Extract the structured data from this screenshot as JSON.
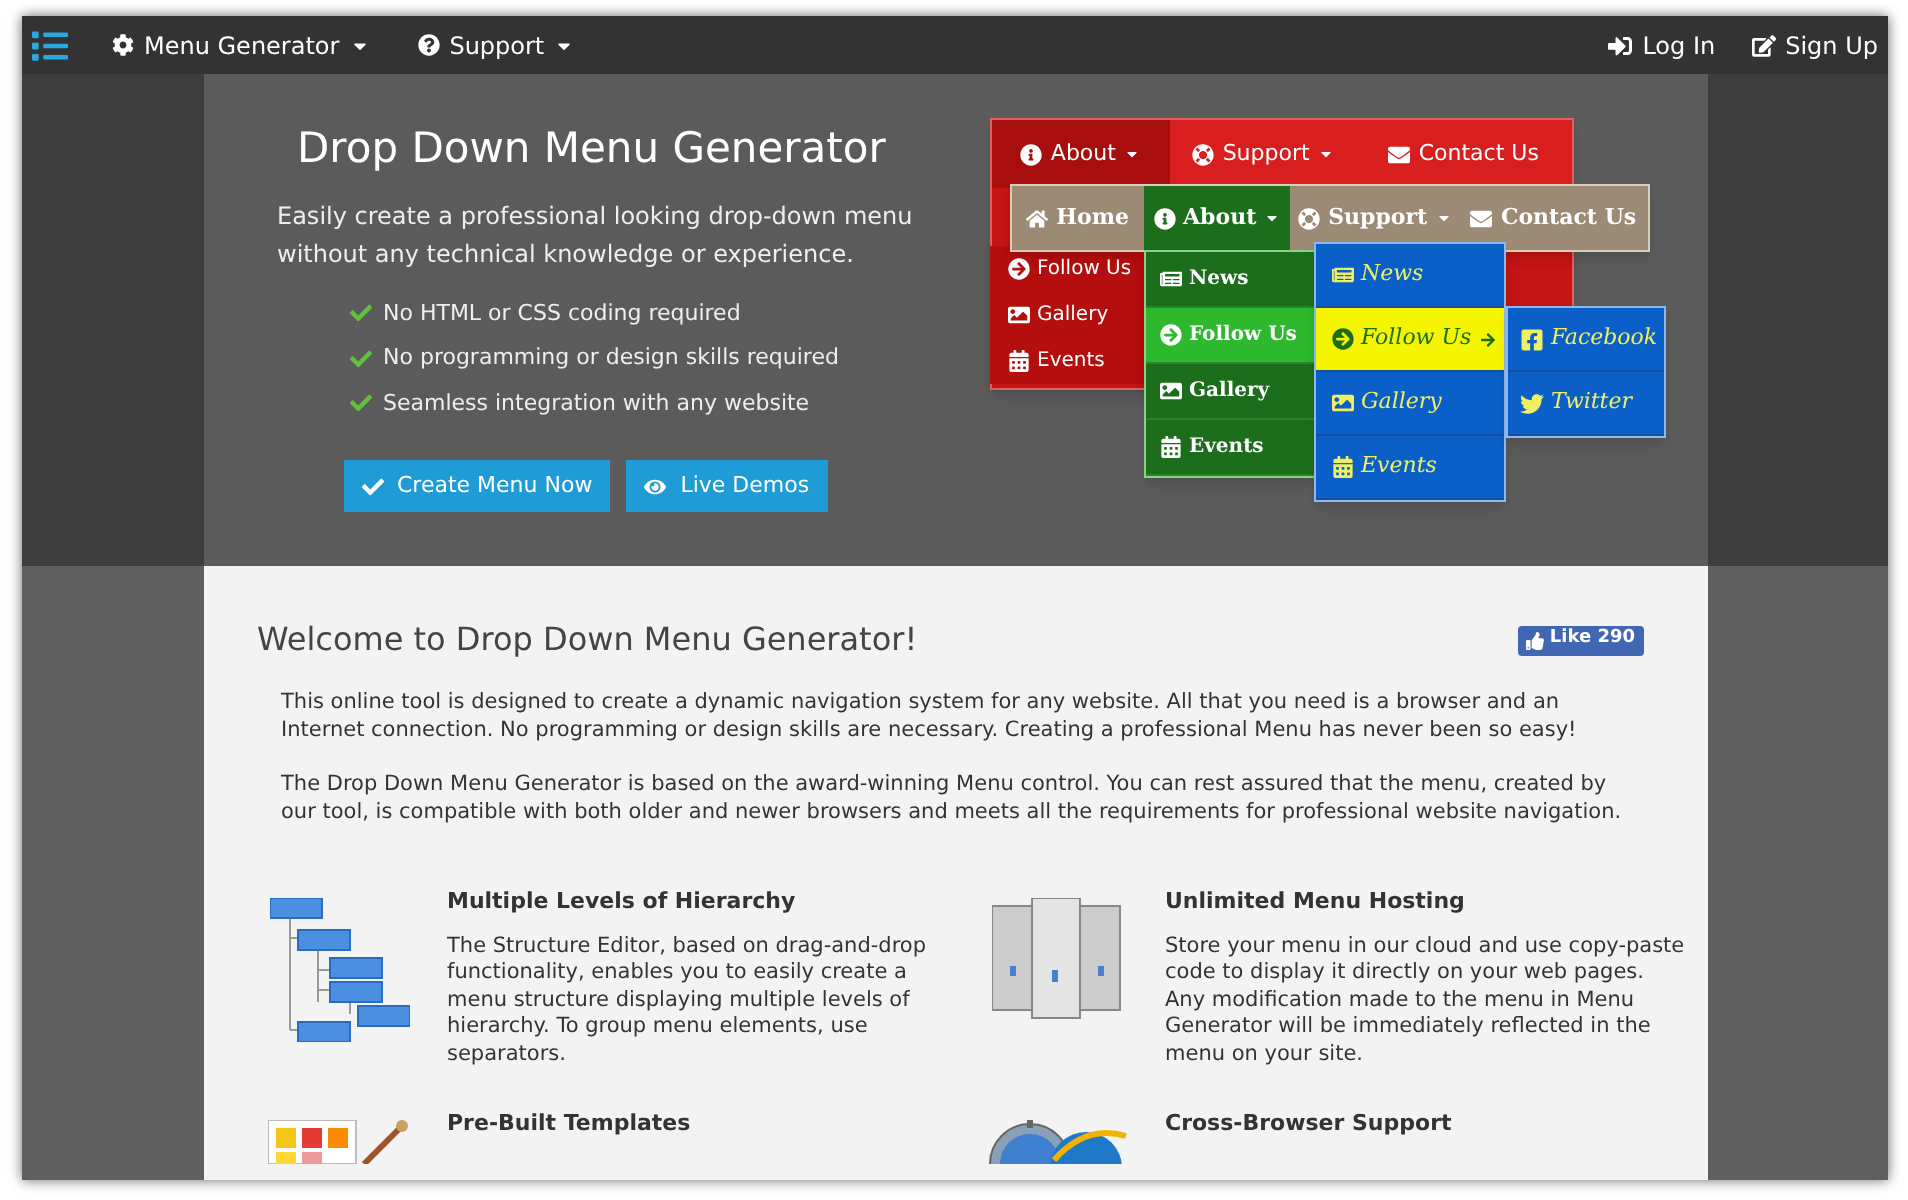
{
  "navbar": {
    "menus": [
      {
        "label": "Menu Generator"
      },
      {
        "label": "Support"
      }
    ],
    "actions": [
      {
        "label": "Log In"
      },
      {
        "label": "Sign Up"
      }
    ]
  },
  "hero": {
    "title": "Drop Down Menu Generator",
    "subtitle": "Easily create a professional looking drop-down menu without any technical knowledge or experience.",
    "features": [
      "No HTML or CSS coding required",
      "No programming or design skills required",
      "Seamless integration with any website"
    ],
    "buttons": [
      {
        "label": "Create Menu Now"
      },
      {
        "label": "Live Demos"
      }
    ]
  },
  "demo": {
    "red_menu": {
      "bar": [
        {
          "label": "About",
          "selected": true
        },
        {
          "label": "Support",
          "selected": false
        },
        {
          "label": "Contact Us",
          "selected": false
        }
      ],
      "dropdown": [
        {
          "label": "Follow Us",
          "selected": false
        },
        {
          "label": "Gallery",
          "selected": false
        },
        {
          "label": "Events",
          "selected": false
        }
      ]
    },
    "tan_menu": {
      "bar": [
        {
          "label": "Home",
          "selected": false
        },
        {
          "label": "About",
          "selected": true
        },
        {
          "label": "Support",
          "selected": false
        },
        {
          "label": "Contact Us",
          "selected": false
        }
      ],
      "dropdown": [
        {
          "label": "News",
          "selected": false
        },
        {
          "label": "Follow Us",
          "selected": true
        },
        {
          "label": "Gallery",
          "selected": false
        },
        {
          "label": "Events",
          "selected": false
        }
      ]
    },
    "blue_menu": {
      "dropdown": [
        {
          "label": "News",
          "selected": false
        },
        {
          "label": "Follow Us",
          "selected": true
        },
        {
          "label": "Gallery",
          "selected": false
        },
        {
          "label": "Events",
          "selected": false
        }
      ],
      "submenu": [
        {
          "label": "Facebook"
        },
        {
          "label": "Twitter"
        }
      ]
    }
  },
  "welcome": {
    "title": "Welcome to Drop Down Menu Generator!",
    "like": {
      "label": "Like",
      "count": "290"
    },
    "paragraphs": [
      "This online tool is designed to create a dynamic navigation system for any website. All that you need is a browser and an Internet connection. No programming or design skills are necessary. Creating a professional Menu has never been so easy!",
      "The Drop Down Menu Generator is based on the award-winning Menu control. You can rest assured that the menu, created by our tool, is compatible with both older and newer browsers and meets all the requirements for professional website navigation."
    ]
  },
  "features": [
    {
      "title": "Multiple Levels of Hierarchy",
      "text": "The Structure Editor, based on drag-and-drop functionality, enables you to easily create a menu structure displaying multiple levels of hierarchy. To group menu elements, use separators."
    },
    {
      "title": "Unlimited Menu Hosting",
      "text": "Store your menu in our cloud and use copy-paste code to display it directly on your web pages. Any modification made to the menu in Menu Generator will be immediately reflected in the menu on your site."
    },
    {
      "title": "Pre-Built Templates"
    },
    {
      "title": "Cross-Browser Support"
    }
  ]
}
